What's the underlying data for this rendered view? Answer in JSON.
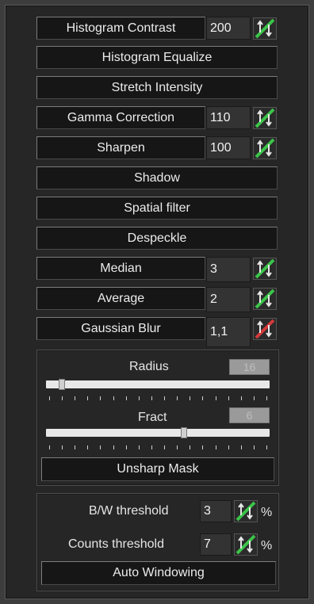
{
  "filters": {
    "histogram_contrast": {
      "label": "Histogram Contrast",
      "value": "200"
    },
    "histogram_equalize": {
      "label": "Histogram Equalize"
    },
    "stretch_intensity": {
      "label": "Stretch Intensity"
    },
    "gamma_correction": {
      "label": "Gamma Correction",
      "value": "110"
    },
    "sharpen": {
      "label": "Sharpen",
      "value": "100"
    },
    "shadow": {
      "label": "Shadow"
    },
    "spatial_filter": {
      "label": "Spatial filter"
    },
    "despeckle": {
      "label": "Despeckle"
    },
    "median": {
      "label": "Median",
      "value": "3"
    },
    "average": {
      "label": "Average",
      "value": "2"
    },
    "gaussian_blur": {
      "label": "Gaussian Blur",
      "value": "1,1"
    }
  },
  "unsharp": {
    "radius_label": "Radius",
    "radius_value": "16",
    "radius_fraction": 0.06,
    "fract_label": "Fract",
    "fract_value": "6",
    "fract_fraction": 0.62,
    "button_label": "Unsharp Mask"
  },
  "windowing": {
    "bw_label": "B/W threshold",
    "bw_value": "3",
    "bw_unit": "%",
    "counts_label": "Counts threshold",
    "counts_value": "7",
    "counts_unit": "%",
    "button_label": "Auto Windowing"
  },
  "icons": {
    "spin_enabled": "green-updown-spin-icon",
    "spin_disabled": "red-disabled-spin-icon"
  },
  "colors": {
    "spin_green": "#3cc44a",
    "spin_red": "#d43a3a"
  }
}
